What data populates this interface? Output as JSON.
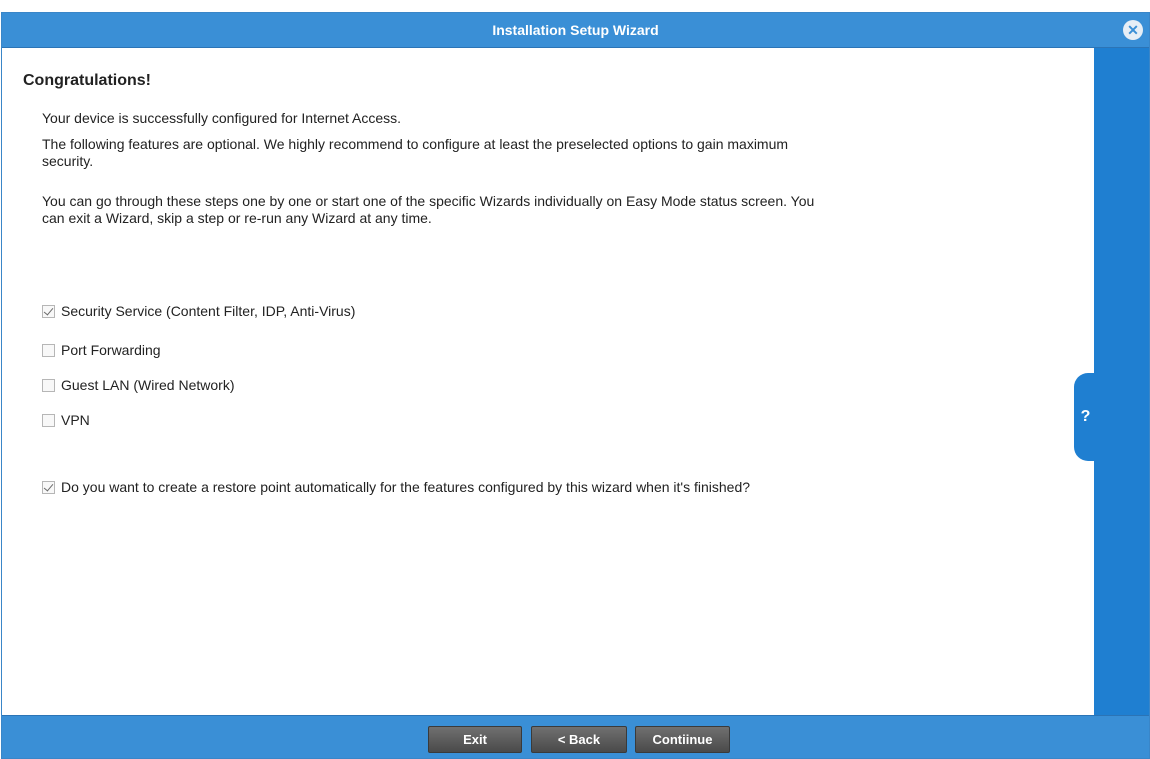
{
  "window": {
    "title": "Installation Setup Wizard"
  },
  "close_glyph": "✕",
  "content": {
    "heading": "Congratulations!",
    "para1": "Your device is successfully configured for Internet Access.",
    "para2": "The following features are optional. We highly recommend to configure at least the preselected options to gain maximum security.",
    "para3": "You can go through these steps one by one or start one of the specific Wizards individually on Easy Mode status screen. You can exit a Wizard, skip a step or re-run any Wizard at any time.",
    "options": [
      {
        "label": "Security Service (Content Filter, IDP, Anti-Virus)",
        "checked": true
      },
      {
        "label": "Port Forwarding",
        "checked": false
      },
      {
        "label": "Guest LAN (Wired Network)",
        "checked": false
      },
      {
        "label": "VPN",
        "checked": false
      }
    ],
    "restore_point": {
      "label": "Do you want to create a restore point automatically for the features configured by this wizard when it's finished?",
      "checked": true
    }
  },
  "help": {
    "glyph": "?"
  },
  "footer": {
    "exit_label": "Exit",
    "back_label": "< Back",
    "continue_label": "Contiinue"
  },
  "colors": {
    "titlebar": "#3a8fd6",
    "sidebar": "#1f7fd1",
    "button": "#5a5a5a"
  }
}
